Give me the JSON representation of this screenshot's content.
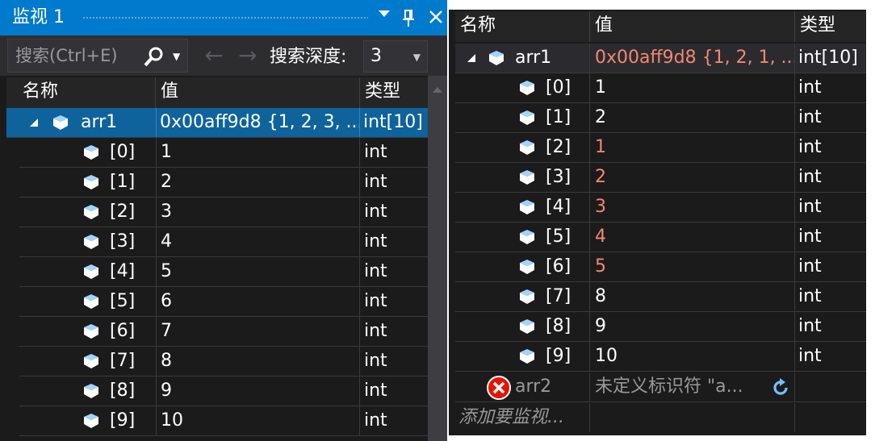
{
  "left_panel": {
    "title": "监视 1",
    "title_buttons": {
      "dropdown": "▾",
      "pin": "Ⴕ",
      "close": "✕"
    },
    "search": {
      "placeholder": "搜索(Ctrl+E)"
    },
    "nav": {
      "back": "←",
      "forward": "→"
    },
    "depth": {
      "label": "搜索深度:",
      "value": "3"
    },
    "columns": {
      "name": "名称",
      "value": "值",
      "type": "类型"
    },
    "rows": [
      {
        "name": "arr1",
        "value": "0x00aff9d8 {1, 2, 3, ...",
        "type": "int[10]"
      },
      {
        "name": "[0]",
        "value": "1",
        "type": "int"
      },
      {
        "name": "[1]",
        "value": "2",
        "type": "int"
      },
      {
        "name": "[2]",
        "value": "3",
        "type": "int"
      },
      {
        "name": "[3]",
        "value": "4",
        "type": "int"
      },
      {
        "name": "[4]",
        "value": "5",
        "type": "int"
      },
      {
        "name": "[5]",
        "value": "6",
        "type": "int"
      },
      {
        "name": "[6]",
        "value": "7",
        "type": "int"
      },
      {
        "name": "[7]",
        "value": "8",
        "type": "int"
      },
      {
        "name": "[8]",
        "value": "9",
        "type": "int"
      },
      {
        "name": "[9]",
        "value": "10",
        "type": "int"
      }
    ]
  },
  "right_panel": {
    "columns": {
      "name": "名称",
      "value": "值",
      "type": "类型"
    },
    "rows": [
      {
        "name": "arr1",
        "value": "0x00aff9d8 {1, 2, 1, ...",
        "type": "int[10]"
      },
      {
        "name": "[0]",
        "value": "1",
        "type": "int"
      },
      {
        "name": "[1]",
        "value": "2",
        "type": "int"
      },
      {
        "name": "[2]",
        "value": "1",
        "type": "int"
      },
      {
        "name": "[3]",
        "value": "2",
        "type": "int"
      },
      {
        "name": "[4]",
        "value": "3",
        "type": "int"
      },
      {
        "name": "[5]",
        "value": "4",
        "type": "int"
      },
      {
        "name": "[6]",
        "value": "5",
        "type": "int"
      },
      {
        "name": "[7]",
        "value": "8",
        "type": "int"
      },
      {
        "name": "[8]",
        "value": "9",
        "type": "int"
      },
      {
        "name": "[9]",
        "value": "10",
        "type": "int"
      }
    ],
    "changed_values_color": "#f48771",
    "error_row": {
      "name": "arr2",
      "value": "未定义标识符 \"a...",
      "type": ""
    },
    "add_watch": "添加要监视..."
  },
  "colors": {
    "accent": "#007acc",
    "selection": "#0e639c",
    "background": "#1b1b1c",
    "header": "#252526",
    "error_icon": "#e51400",
    "refresh_icon": "#75beff"
  },
  "icons": [
    "cube-icon",
    "expand-triangle-icon",
    "search-icon",
    "pin-icon",
    "close-icon",
    "error-icon",
    "refresh-icon"
  ]
}
